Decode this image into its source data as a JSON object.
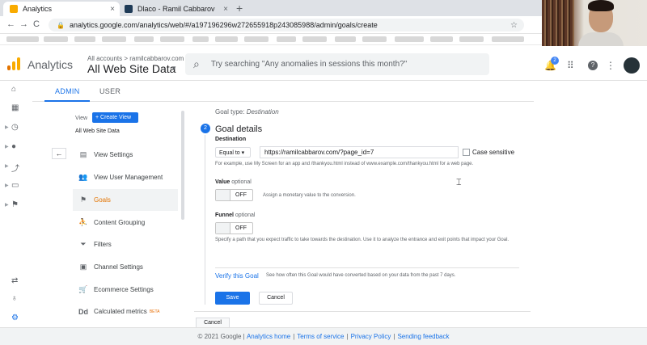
{
  "browser": {
    "tabs": [
      {
        "label": "Analytics",
        "close": "×"
      },
      {
        "label": "Dlaco - Ramil Cabbarov",
        "close": "×"
      }
    ],
    "new_tab": "+",
    "url": "analytics.google.com/analytics/web/#/a197196296w272655918p243085988/admin/goals/create",
    "nav": {
      "back": "←",
      "forward": "→",
      "reload": "C"
    }
  },
  "header": {
    "app_name": "Analytics",
    "breadcrumb": "All accounts > ramilcabbarov.com",
    "property": "All Web Site Data",
    "search_placeholder": "Try searching \"Any anomalies in sessions this month?\"",
    "notification_count": "2"
  },
  "admin_tabs": {
    "admin": "ADMIN",
    "user": "USER"
  },
  "view_column": {
    "view_label": "View",
    "create_view": "+ Create View",
    "view_name": "All Web Site Data",
    "items": [
      {
        "label": "View Settings",
        "icon": "document-icon"
      },
      {
        "label": "View User Management",
        "icon": "people-icon"
      },
      {
        "label": "Goals",
        "icon": "flag-icon"
      },
      {
        "label": "Content Grouping",
        "icon": "walk-icon"
      },
      {
        "label": "Filters",
        "icon": "filter-icon"
      },
      {
        "label": "Channel Settings",
        "icon": "settings-icon"
      },
      {
        "label": "Ecommerce Settings",
        "icon": "cart-icon"
      },
      {
        "label": "Calculated metrics",
        "icon": "dd-icon",
        "badge": "BETA"
      }
    ]
  },
  "goal_form": {
    "goal_type_label": "Goal type:",
    "goal_type_value": "Destination",
    "step_number": "2",
    "section_title": "Goal details",
    "destination_label": "Destination",
    "match_type": "Equal to ▾",
    "destination_value": "https://ramilcabbarov.com/?page_id=7",
    "case_sensitive_label": "Case sensitive",
    "destination_hint": "For example, use My Screen for an app and /thankyou.html instead of www.example.com/thankyou.html for a web page.",
    "value_label": "Value",
    "value_optional": "optional",
    "value_toggle": "OFF",
    "value_hint": "Assign a monetary value to the conversion.",
    "funnel_label": "Funnel",
    "funnel_optional": "optional",
    "funnel_toggle": "OFF",
    "funnel_hint": "Specify a path that you expect traffic to take towards the destination. Use it to analyze the entrance and exit points that impact your Goal.",
    "verify_link": "Verify this Goal",
    "verify_desc": "See how often this Goal would have converted based on your data from the past 7 days.",
    "save": "Save",
    "cancel": "Cancel",
    "outer_cancel": "Cancel"
  },
  "footer": {
    "copyright": "© 2021 Google |",
    "links": [
      "Analytics home",
      "Terms of service",
      "Privacy Policy",
      "Sending feedback"
    ]
  },
  "colors": {
    "accent": "#1a73e8",
    "logo_orange": "#f9ab00",
    "logo_dark": "#e37400"
  }
}
